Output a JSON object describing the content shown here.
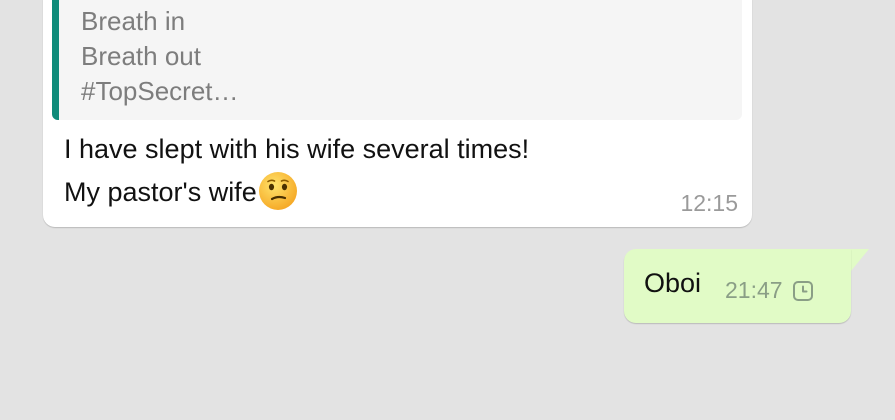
{
  "incoming_message": {
    "quoted_lines": [
      "Breath in",
      "Breath out",
      "#TopSecret…"
    ],
    "text_line_1": "I have slept with his wife several times!",
    "text_line_2": "My pastor's wife",
    "emoji": "confused-face-icon",
    "time": "12:15"
  },
  "outgoing_message": {
    "text": "Oboi",
    "time": "21:47",
    "status_icon": "clock-pending-icon"
  },
  "colors": {
    "background": "#e3e3e3",
    "incoming_bubble": "#ffffff",
    "outgoing_bubble": "#e1fbc6",
    "quote_accent": "#0f8b7a"
  }
}
